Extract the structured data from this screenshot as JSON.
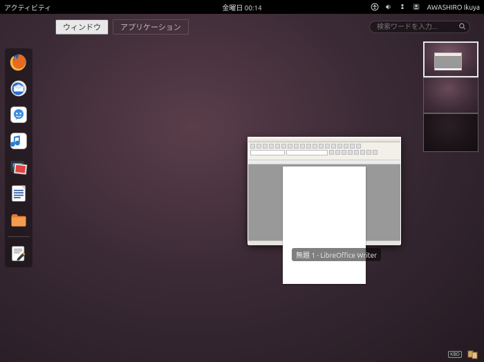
{
  "panel": {
    "activities_label": "アクティビティ",
    "clock": "金曜日 00:14",
    "user": "AWASHIRO Ikuya"
  },
  "overview": {
    "tab_windows": "ウィンドウ",
    "tab_applications": "アプリケーション",
    "search_placeholder": "検索ワードを入力..."
  },
  "window": {
    "label": "無題 1 - LibreOffice Writer"
  },
  "workspaces": {
    "caption": ""
  },
  "tray": {
    "kbd_label": "KBD"
  },
  "dock": {
    "items": [
      "firefox",
      "thunderbird",
      "empathy",
      "banshee",
      "shotwell",
      "libreoffice-writer",
      "nautilus",
      "gedit"
    ]
  }
}
